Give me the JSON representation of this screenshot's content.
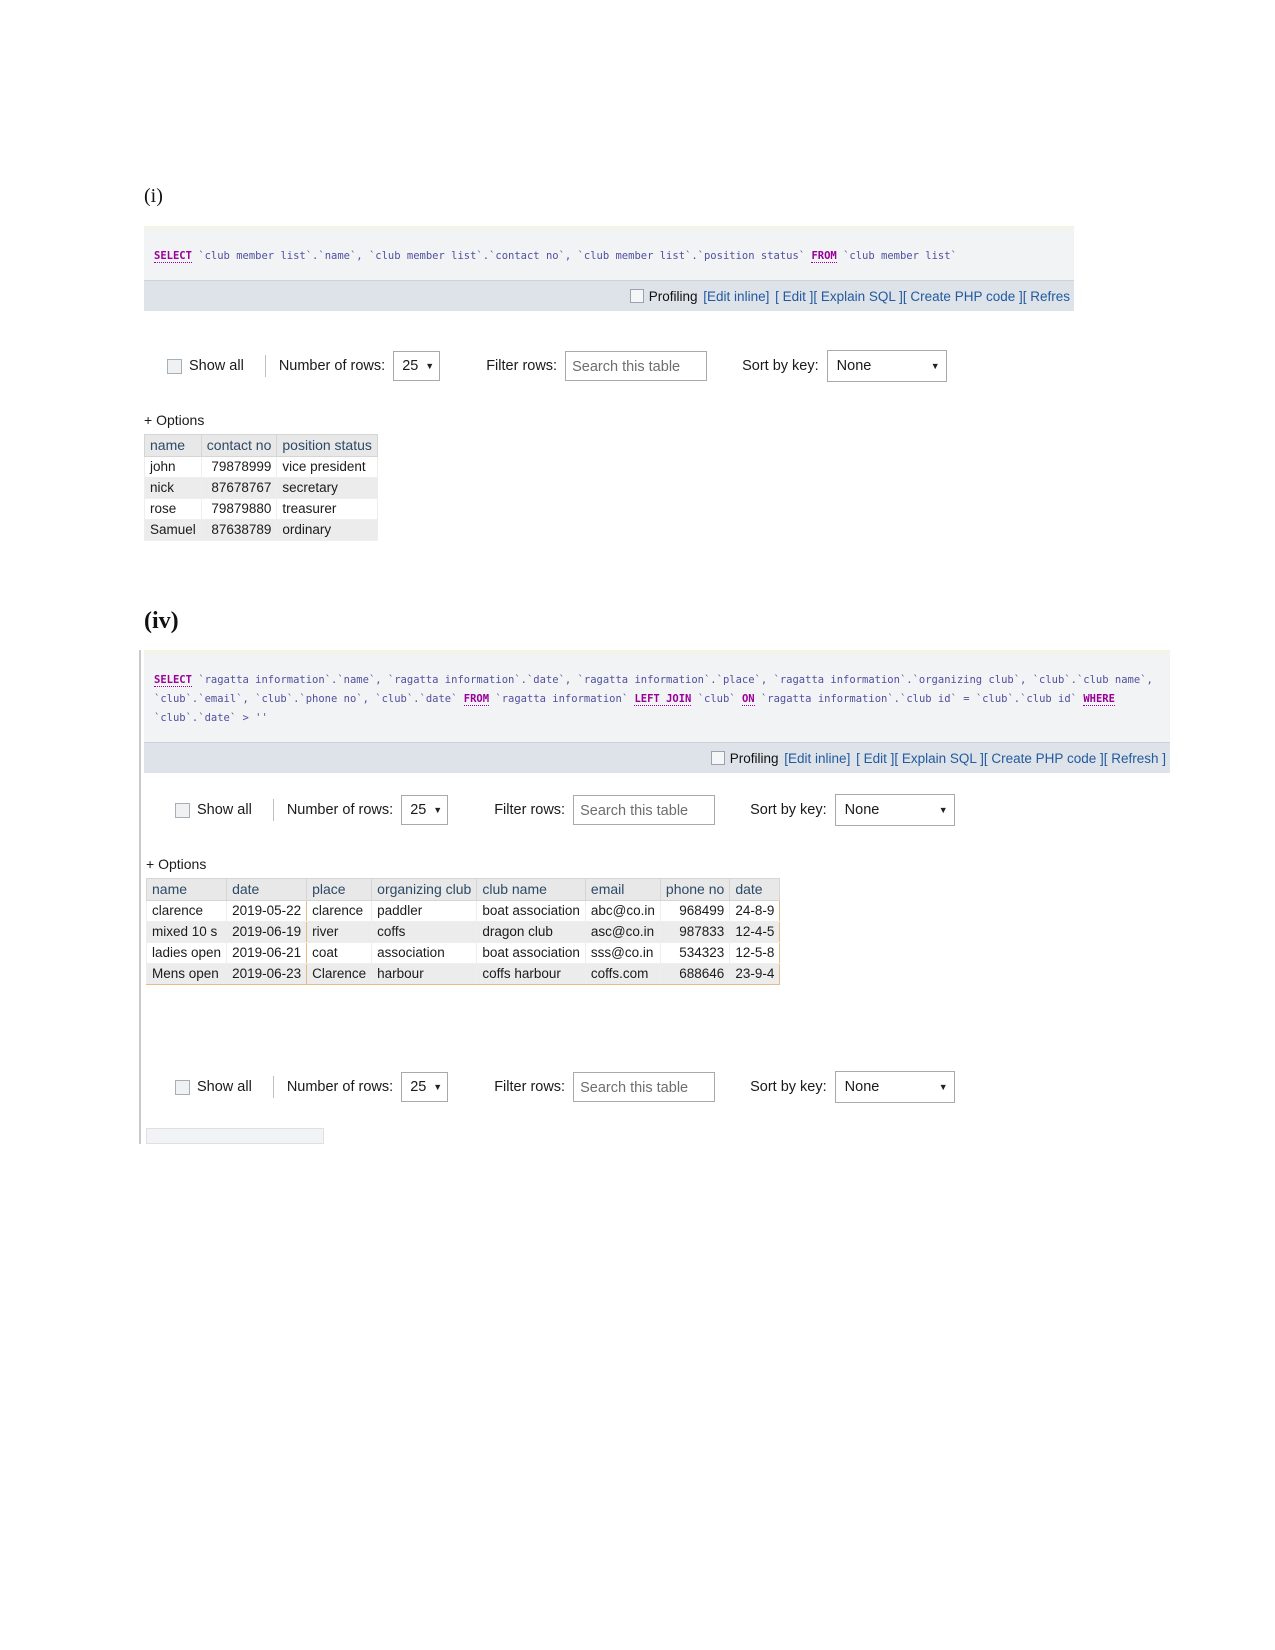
{
  "sections": [
    {
      "label": "(i)",
      "sql_parts": {
        "kw_select": "SELECT",
        "body": " `club member list`.`name`, `club member list`.`contact no`, `club member list`.`position status` ",
        "kw_from": "FROM",
        "tail": " `club member list`"
      },
      "actions": {
        "profiling": "Profiling",
        "edit_inline": "[Edit inline]",
        "edit": "[ Edit ]",
        "explain_sql": "[ Explain SQL ]",
        "create_php": "[ Create PHP code ]",
        "refresh": "[ Refres"
      },
      "controls": {
        "show_all": "Show all",
        "number_of_rows_label": "Number of rows:",
        "number_of_rows_value": "25",
        "filter_rows_label": "Filter rows:",
        "filter_placeholder": "Search this table",
        "sort_by_key_label": "Sort by key:",
        "sort_by_key_value": "None",
        "caret": "▼"
      },
      "options_label": "+ Options",
      "table": {
        "columns": [
          "name",
          "contact no",
          "position status"
        ],
        "rows": [
          [
            "john",
            "79878999",
            "vice president"
          ],
          [
            "nick",
            "87678767",
            "secretary"
          ],
          [
            "rose",
            "79879880",
            "treasurer"
          ],
          [
            "Samuel",
            "87638789",
            "ordinary"
          ]
        ]
      }
    },
    {
      "label": "(iv)",
      "sql_parts": {
        "kw_select": "SELECT",
        "body": " `ragatta information`.`name`, `ragatta information`.`date`, `ragatta information`.`place`, `ragatta information`.`organizing club`, `club`.`club name`, `club`.`email`, `club`.`phone no`, `club`.`date` ",
        "kw_from": "FROM",
        "mid1": " `ragatta information` ",
        "kw_join": "LEFT JOIN",
        "mid2": " `club` ",
        "kw_on": "ON",
        "mid3": " `ragatta information`.`club id` = `club`.`club id` ",
        "kw_where": "WHERE",
        "tail": " `club`.`date` > ''"
      },
      "actions": {
        "profiling": "Profiling",
        "edit_inline": "[Edit inline]",
        "edit": "[ Edit ]",
        "explain_sql": "[ Explain SQL ]",
        "create_php": "[ Create PHP code ]",
        "refresh": "[ Refresh ]"
      },
      "controls": {
        "show_all": "Show all",
        "number_of_rows_label": "Number of rows:",
        "number_of_rows_value": "25",
        "filter_rows_label": "Filter rows:",
        "filter_placeholder": "Search this table",
        "sort_by_key_label": "Sort by key:",
        "sort_by_key_value": "None",
        "caret": "▼"
      },
      "controls_bottom": {
        "show_all": "Show all",
        "number_of_rows_label": "Number of rows:",
        "number_of_rows_value": "25",
        "filter_rows_label": "Filter rows:",
        "filter_placeholder": "Search this table",
        "sort_by_key_label": "Sort by key:",
        "sort_by_key_value": "None",
        "caret": "▼"
      },
      "options_label": "+ Options",
      "table": {
        "columns": [
          "name",
          "date",
          "place",
          "organizing club",
          "club name",
          "email",
          "phone no",
          "date"
        ],
        "rows": [
          [
            "clarence",
            "2019-05-22",
            "clarence",
            "paddler",
            "boat association",
            "abc@co.in",
            "968499",
            "24-8-9"
          ],
          [
            "mixed 10 s",
            "2019-06-19",
            "river",
            "coffs",
            "dragon club",
            "asc@co.in",
            "987833",
            "12-4-5"
          ],
          [
            "ladies open",
            "2019-06-21",
            "coat",
            "association",
            "boat association",
            "sss@co.in",
            "534323",
            "12-5-8"
          ],
          [
            "Mens open",
            "2019-06-23",
            "Clarence",
            "harbour",
            "coffs harbour",
            "coffs.com",
            "688646",
            "23-9-4"
          ]
        ]
      }
    }
  ]
}
